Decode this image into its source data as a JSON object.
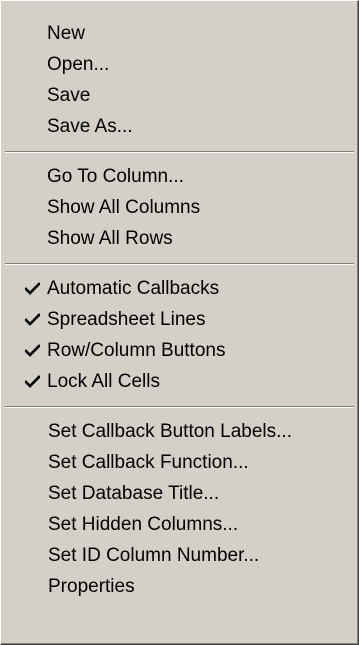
{
  "menu": {
    "file_group": [
      {
        "label": "New"
      },
      {
        "label": "Open..."
      },
      {
        "label": "Save"
      },
      {
        "label": "Save As..."
      }
    ],
    "navigate_group": [
      {
        "label": "Go To Column..."
      },
      {
        "label": "Show All Columns"
      },
      {
        "label": "Show All Rows"
      }
    ],
    "toggle_group": [
      {
        "label": "Automatic Callbacks",
        "checked": true
      },
      {
        "label": "Spreadsheet Lines",
        "checked": true
      },
      {
        "label": "Row/Column Buttons",
        "checked": true
      },
      {
        "label": "Lock All Cells",
        "checked": true
      }
    ],
    "settings_group": [
      {
        "label": "Set Callback Button Labels..."
      },
      {
        "label": "Set Callback Function..."
      },
      {
        "label": "Set Database Title..."
      },
      {
        "label": "Set Hidden Columns..."
      },
      {
        "label": "Set ID Column Number..."
      },
      {
        "label": "Properties"
      }
    ],
    "check_icon": "checkmark-icon",
    "colors": {
      "face": "#d4d0c8",
      "text": "#000000",
      "shadow": "#808080",
      "highlight": "#ffffff"
    }
  }
}
